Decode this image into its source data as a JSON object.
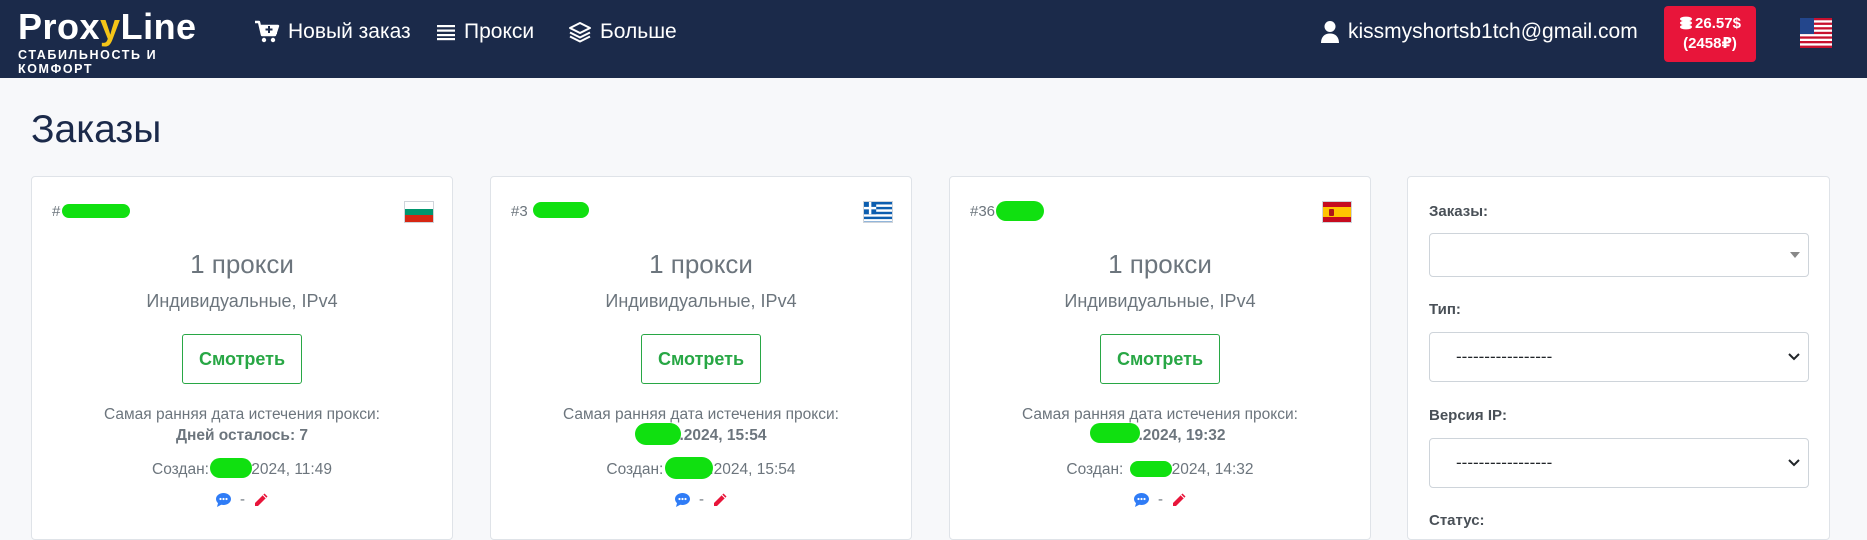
{
  "nav": {
    "logo_proxy": "Prox",
    "logo_y": "y",
    "logo_line": "Line",
    "logo_tagline": "СТАБИЛЬНОСТЬ И КОМФОРТ",
    "new_order": "Новый заказ",
    "proxies": "Прокси",
    "more": "Больше",
    "user_email": "kissmyshortsb1tch@gmail.com",
    "balance_usd": "26.57$",
    "balance_rub": "(2458₽)"
  },
  "page": {
    "title": "Заказы"
  },
  "orders": [
    {
      "id": "#",
      "country": "bulgaria",
      "count": "1 прокси",
      "type": "Индивидуальные, IPv4",
      "view_label": "Смотреть",
      "expiry_label": "Самая ранняя дата истечения прокси:",
      "expiry_value": "Дней осталось: 7",
      "created_prefix": "Создан:",
      "created_value": ".2024, 11:49",
      "separator": "-"
    },
    {
      "id": "#3",
      "country": "greece",
      "count": "1 прокси",
      "type": "Индивидуальные, IPv4",
      "view_label": "Смотреть",
      "expiry_label": "Самая ранняя дата истечения прокси:",
      "expiry_value": ".2024, 15:54",
      "created_prefix": "Создан:",
      "created_value": ".2024, 15:54",
      "separator": "-"
    },
    {
      "id": "#36",
      "country": "spain",
      "count": "1 прокси",
      "type": "Индивидуальные, IPv4",
      "view_label": "Смотреть",
      "expiry_label": "Самая ранняя дата истечения прокси:",
      "expiry_value": ".2024, 19:32",
      "created_prefix": "Создан:",
      "created_value": ".2024, 14:32",
      "separator": "-"
    }
  ],
  "filter": {
    "orders_label": "Заказы:",
    "orders_value": "",
    "type_label": "Тип:",
    "type_value": "-----------------",
    "ip_label": "Версия IP:",
    "ip_value": "-----------------",
    "status_label": "Статус:"
  },
  "colors": {
    "navbar": "#1b2a4a",
    "accent_red": "#e8153a",
    "success": "#28a745",
    "comment": "#2f7cf6",
    "redaction": "#10e010"
  }
}
